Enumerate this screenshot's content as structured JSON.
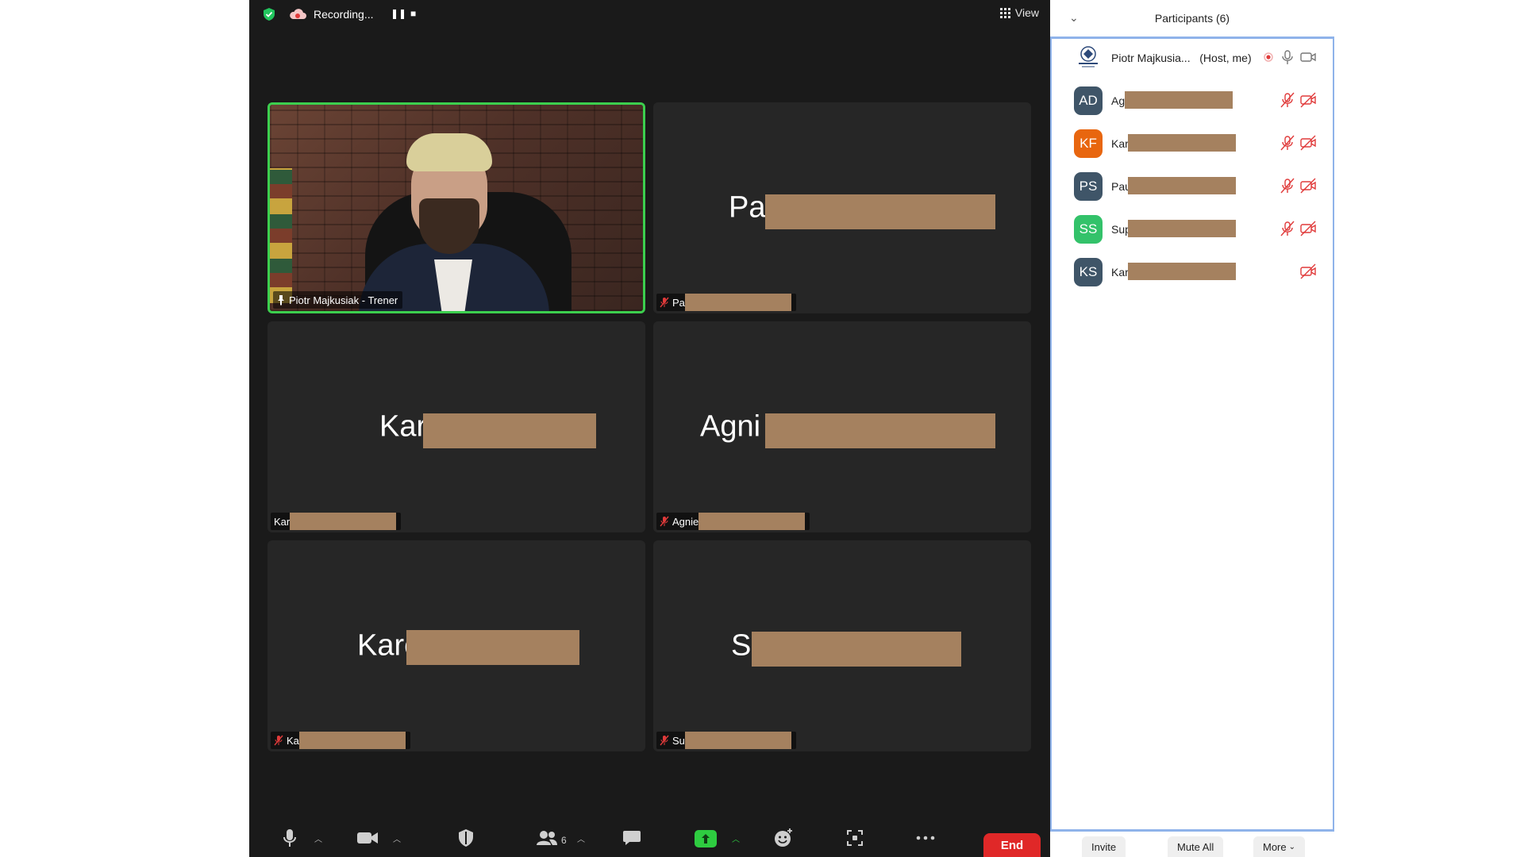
{
  "topbar": {
    "recording_label": "Recording...",
    "pause_glyph": "❚❚",
    "stop_glyph": "■",
    "view_label": "View"
  },
  "tiles": [
    {
      "name_tag": "Piotr Majkusiak - Trener",
      "big_name": "",
      "video": true
    },
    {
      "name_tag": "Pa",
      "big_name": "Pa"
    },
    {
      "name_tag": "Kar",
      "big_name": "Kar"
    },
    {
      "name_tag": "Agnie",
      "big_name": "Agni"
    },
    {
      "name_tag": "Ka",
      "big_name": "Karc"
    },
    {
      "name_tag": "Su",
      "big_name": "S"
    }
  ],
  "toolbar": {
    "participants_count": "6",
    "end_label": "End"
  },
  "panel": {
    "title": "Participants (6)",
    "host": {
      "name": "Piotr Majkusia...",
      "role": "(Host, me)"
    },
    "participants": [
      {
        "initials": "AD",
        "name": "Ag",
        "color": "#3f5568"
      },
      {
        "initials": "KF",
        "name": "Kar",
        "color": "#e8660f"
      },
      {
        "initials": "PS",
        "name": "Pau",
        "color": "#3f5568"
      },
      {
        "initials": "SS",
        "name": "Sup",
        "color": "#33c26a"
      },
      {
        "initials": "KS",
        "name": "Kar",
        "color": "#3f5568"
      }
    ],
    "invite_label": "Invite",
    "mute_all_label": "Mute All",
    "more_label": "More"
  },
  "colors": {
    "redaction": "#a5815f",
    "active_border": "#3ccf4e",
    "muted_red": "#e03a3a",
    "end_red": "#e02828",
    "share_green": "#2ecc40"
  }
}
